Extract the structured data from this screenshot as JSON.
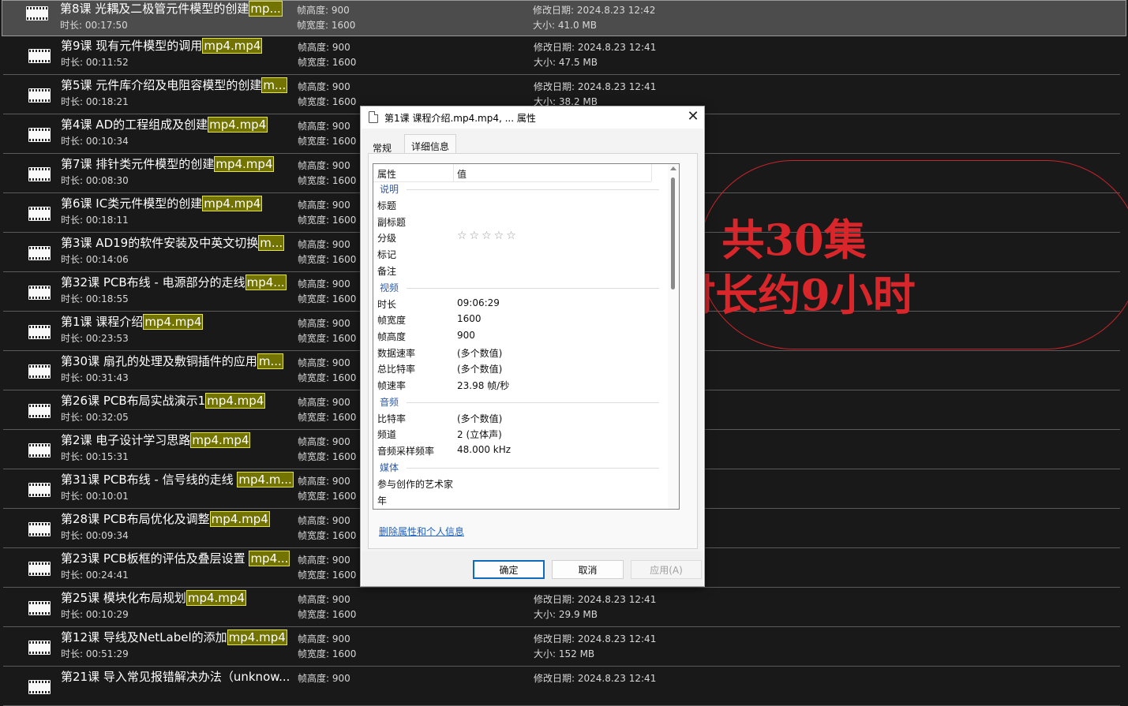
{
  "files": [
    {
      "title": "第8课 光耦及二极管元件模型的创建",
      "ext": "mp...",
      "duration": "时长: 00:17:50",
      "height": "帧高度: 900",
      "width": "帧宽度: 1600",
      "modified": "修改日期: 2024.8.23 12:42",
      "size": "大小: 41.0 MB"
    },
    {
      "title": "第9课 现有元件模型的调用",
      "ext": "mp4.mp4",
      "duration": "时长: 00:11:52",
      "height": "帧高度: 900",
      "width": "帧宽度: 1600",
      "modified": "修改日期: 2024.8.23 12:41",
      "size": "大小: 47.5 MB"
    },
    {
      "title": "第5课 元件库介绍及电阻容模型的创建",
      "ext": "m...",
      "duration": "时长: 00:18:21",
      "height": "帧高度: 900",
      "width": "帧宽度: 1600",
      "modified": "修改日期: 2024.8.23 12:41",
      "size": "大小: 38.2 MB"
    },
    {
      "title": "第4课 AD的工程组成及创建",
      "ext": "mp4.mp4",
      "duration": "时长: 00:10:34",
      "height": "帧高度: 900",
      "width": "帧宽度: 1600",
      "modified": "",
      "size": ""
    },
    {
      "title": "第7课 排针类元件模型的创建",
      "ext": "mp4.mp4",
      "duration": "时长: 00:08:30",
      "height": "帧高度: 900",
      "width": "帧宽度: 1600",
      "modified": "",
      "size": ""
    },
    {
      "title": "第6课 IC类元件模型的创建",
      "ext": "mp4.mp4",
      "duration": "时长: 00:18:11",
      "height": "帧高度: 900",
      "width": "帧宽度: 1600",
      "modified": "",
      "size": ""
    },
    {
      "title": "第3课 AD19的软件安装及中英文切换",
      "ext": "m...",
      "duration": "时长: 00:14:06",
      "height": "帧高度: 900",
      "width": "帧宽度: 1600",
      "modified": "",
      "size": ""
    },
    {
      "title": "第32课 PCB布线 - 电源部分的走线",
      "ext": "mp4...",
      "duration": "时长: 00:18:55",
      "height": "帧高度: 900",
      "width": "帧宽度: 1600",
      "modified": "",
      "size": ""
    },
    {
      "title": "第1课 课程介绍",
      "ext": "mp4.mp4",
      "duration": "时长: 00:23:53",
      "height": "帧高度: 900",
      "width": "帧宽度: 1600",
      "modified": "",
      "size": ""
    },
    {
      "title": "第30课 扇孔的处理及敷铜插件的应用",
      "ext": "m...",
      "duration": "时长: 00:31:43",
      "height": "帧高度: 900",
      "width": "帧宽度: 1600",
      "modified": "",
      "size": ""
    },
    {
      "title": "第26课 PCB布局实战演示1",
      "ext": "mp4.mp4",
      "duration": "时长: 00:32:05",
      "height": "帧高度: 900",
      "width": "帧宽度: 1600",
      "modified": "",
      "size": ""
    },
    {
      "title": "第2课 电子设计学习思路",
      "ext": "mp4.mp4",
      "duration": "时长: 00:15:31",
      "height": "帧高度: 900",
      "width": "帧宽度: 1600",
      "modified": "",
      "size": ""
    },
    {
      "title": "第31课 PCB布线 - 信号线的走线 ",
      "ext": "mp4.m...",
      "duration": "时长: 00:10:01",
      "height": "帧高度: 900",
      "width": "帧宽度: 1600",
      "modified": "",
      "size": ""
    },
    {
      "title": "第28课 PCB布局优化及调整",
      "ext": "mp4.mp4",
      "duration": "时长: 00:09:34",
      "height": "帧高度: 900",
      "width": "帧宽度: 1600",
      "modified": "",
      "size": ""
    },
    {
      "title": "第23课 PCB板框的评估及叠层设置 ",
      "ext": "mp4...",
      "duration": "时长: 00:24:41",
      "height": "帧高度: 900",
      "width": "帧宽度: 1600",
      "modified": "",
      "size": ""
    },
    {
      "title": "第25课 模块化布局规划",
      "ext": "mp4.mp4",
      "duration": "时长: 00:10:29",
      "height": "帧高度: 900",
      "width": "帧宽度: 1600",
      "modified": "修改日期: 2024.8.23 12:41",
      "size": "大小: 29.9 MB"
    },
    {
      "title": "第12课 导线及NetLabel的添加",
      "ext": "mp4.mp4",
      "duration": "时长: 00:51:29",
      "height": "帧高度: 900",
      "width": "帧宽度: 1600",
      "modified": "修改日期: 2024.8.23 12:41",
      "size": "大小: 152 MB"
    },
    {
      "title": "第21课 导入常见报错解决办法（unknow...",
      "ext": "",
      "duration": "",
      "height": "帧高度: 900",
      "width": "",
      "modified": "修改日期: 2024.8.23 12:41",
      "size": ""
    }
  ],
  "annotation": {
    "line1": "共30集",
    "line2": "时长约9小时"
  },
  "dialog": {
    "title": "第1课 课程介绍.mp4.mp4, ... 属性",
    "close": "✕",
    "tabs": {
      "general": "常规",
      "details": "详细信息"
    },
    "header": {
      "property": "属性",
      "value": "值"
    },
    "sections": {
      "description": "说明",
      "video": "视频",
      "audio": "音频",
      "media": "媒体"
    },
    "desc_rows": {
      "title": "标题",
      "subtitle": "副标题",
      "rating": "分级",
      "tags": "标记",
      "comments": "备注"
    },
    "rating_stars": "☆☆☆☆☆",
    "video_rows": [
      {
        "key": "时长",
        "value": "09:06:29"
      },
      {
        "key": "帧宽度",
        "value": "1600"
      },
      {
        "key": "帧高度",
        "value": "900"
      },
      {
        "key": "数据速率",
        "value": "(多个数值)"
      },
      {
        "key": "总比特率",
        "value": "(多个数值)"
      },
      {
        "key": "帧速率",
        "value": "23.98 帧/秒"
      }
    ],
    "audio_rows": [
      {
        "key": "比特率",
        "value": "(多个数值)"
      },
      {
        "key": "频道",
        "value": "2 (立体声)"
      },
      {
        "key": "音频采样频率",
        "value": "48.000 kHz"
      }
    ],
    "media_rows": [
      {
        "key": "参与创作的艺术家",
        "value": ""
      },
      {
        "key": "年",
        "value": ""
      }
    ],
    "remove_link": "删除属性和个人信息",
    "buttons": {
      "ok": "确定",
      "cancel": "取消",
      "apply": "应用(A)"
    }
  }
}
